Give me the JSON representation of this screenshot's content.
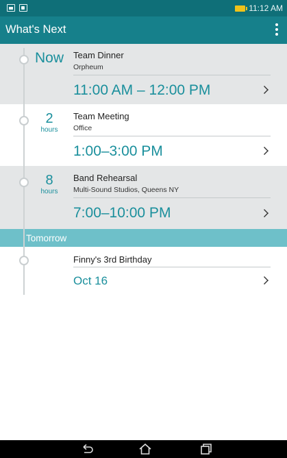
{
  "status_bar": {
    "left_icons": [
      "gallery-notification-icon",
      "calendar-notification-icon"
    ],
    "battery_icon": "battery-charging-icon",
    "time": "11:12 AM"
  },
  "app_bar": {
    "title": "What's Next",
    "menu_icon": "overflow-menu-icon"
  },
  "events": [
    {
      "when": "Now",
      "unit": "",
      "title": "Team Dinner",
      "location": "Orpheum",
      "time": "11:00 AM – 12:00 PM"
    },
    {
      "when": "2",
      "unit": "hours",
      "title": "Team Meeting",
      "location": "Office",
      "time": "1:00–3:00 PM"
    },
    {
      "when": "8",
      "unit": "hours",
      "title": "Band Rehearsal",
      "location": "Multi-Sound Studios, Queens NY",
      "time": "7:00–10:00 PM"
    }
  ],
  "tomorrow": {
    "header": "Tomorrow",
    "events": [
      {
        "title": "Finny's 3rd Birthday",
        "date": "Oct 16"
      }
    ]
  },
  "nav_bar": {
    "buttons": [
      "back-icon",
      "home-icon",
      "recent-apps-icon"
    ]
  },
  "colors": {
    "status_bar": "#0f6f78",
    "app_bar": "#16808b",
    "accent": "#1a8f9c",
    "section_header": "#6ec0c9",
    "grey_card": "#e4e6e7",
    "battery": "#f0c21a"
  }
}
